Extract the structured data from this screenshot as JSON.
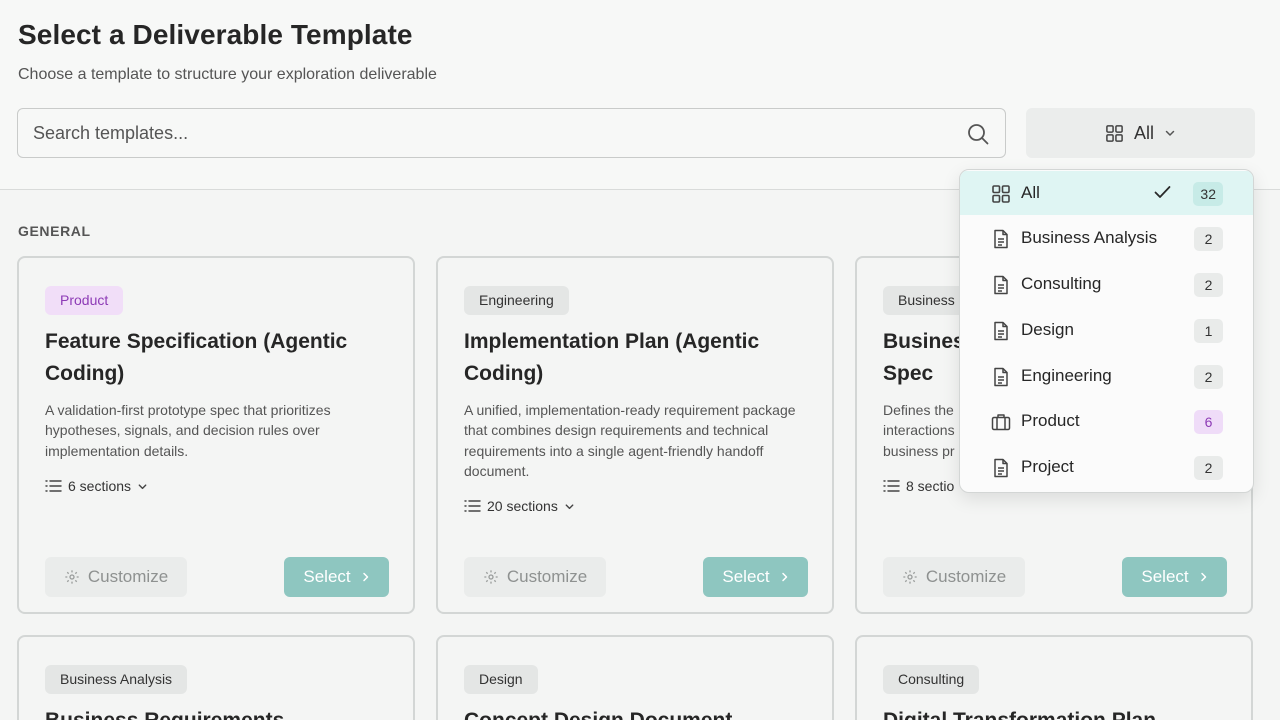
{
  "header": {
    "title": "Select a Deliverable Template",
    "subtitle": "Choose a template to structure your exploration deliverable"
  },
  "search": {
    "placeholder": "Search templates...",
    "value": ""
  },
  "filter": {
    "selected": "All"
  },
  "section": {
    "label": "GENERAL"
  },
  "cards": [
    {
      "tag": "Product",
      "title": "Feature Specification (Agentic Coding)",
      "description": "A validation-first prototype spec that prioritizes hypotheses, signals, and decision rules over implementation details.",
      "sections": "6 sections",
      "customize": "Customize",
      "select": "Select"
    },
    {
      "tag": "Engineering",
      "title": "Implementation Plan (Agentic Coding)",
      "description": "A unified, implementation-ready requirement package that combines design requirements and technical requirements into a single agent-friendly handoff document.",
      "sections": "20 sections",
      "customize": "Customize",
      "select": "Select"
    },
    {
      "tag": "Business",
      "title": "Busines Spec",
      "description": "Defines the interactions business pr",
      "sections": "8 sectio",
      "customize": "Customize",
      "select": "Select"
    },
    {
      "tag": "Business Analysis",
      "title": "Business Requirements"
    },
    {
      "tag": "Design",
      "title": "Concept Design Document"
    },
    {
      "tag": "Consulting",
      "title": "Digital Transformation Plan"
    }
  ],
  "dropdown": {
    "items": [
      {
        "label": "All",
        "count": "32",
        "icon": "grid-icon",
        "selected": true
      },
      {
        "label": "Business Analysis",
        "count": "2",
        "icon": "document-icon"
      },
      {
        "label": "Consulting",
        "count": "2",
        "icon": "document-icon"
      },
      {
        "label": "Design",
        "count": "1",
        "icon": "document-icon"
      },
      {
        "label": "Engineering",
        "count": "2",
        "icon": "document-icon"
      },
      {
        "label": "Product",
        "count": "6",
        "icon": "briefcase-icon"
      },
      {
        "label": "Project",
        "count": "2",
        "icon": "document-icon"
      }
    ]
  },
  "colors": {
    "accent_teal": "#8ec6c0",
    "selected_row": "#dff5f3",
    "product_tag_bg": "#f1def8",
    "product_tag_text": "#8d3bb6"
  }
}
